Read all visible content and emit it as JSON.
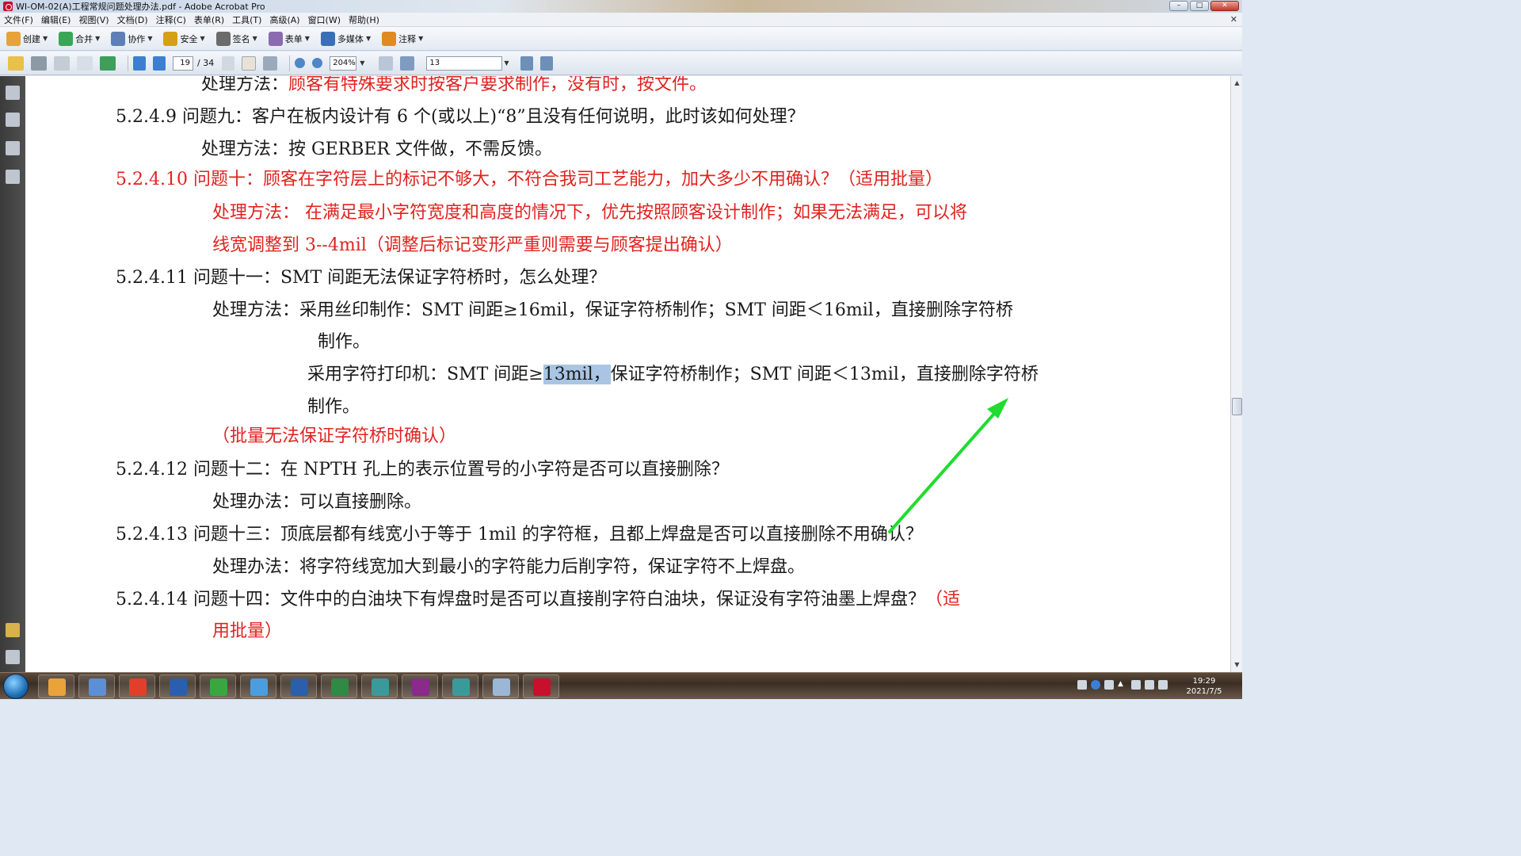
{
  "window": {
    "title": "WI-OM-02(A)工程常规问题处理办法.pdf - Adobe Acrobat Pro",
    "controls": {
      "minimize": "–",
      "maximize": "□",
      "close": "✕"
    }
  },
  "menu": {
    "items": [
      "文件(F)",
      "编辑(E)",
      "视图(V)",
      "文档(D)",
      "注释(C)",
      "表单(R)",
      "工具(T)",
      "高级(A)",
      "窗口(W)",
      "帮助(H)"
    ],
    "close": "✕"
  },
  "toolbar1": {
    "buttons": [
      {
        "label": "创建",
        "icon": "create-icon",
        "color": "#e8a23a"
      },
      {
        "label": "合并",
        "icon": "combine-icon",
        "color": "#3aa655"
      },
      {
        "label": "协作",
        "icon": "collaborate-icon",
        "color": "#5d7fb5"
      },
      {
        "label": "安全",
        "icon": "lock-icon",
        "color": "#d4a017"
      },
      {
        "label": "签名",
        "icon": "pen-icon",
        "color": "#6b6b6b"
      },
      {
        "label": "表单",
        "icon": "form-icon",
        "color": "#8a6bb0"
      },
      {
        "label": "多媒体",
        "icon": "multimedia-icon",
        "color": "#3b6fb5"
      },
      {
        "label": "注释",
        "icon": "comment-icon",
        "color": "#e08a20"
      }
    ]
  },
  "toolbar2": {
    "current_page": "19",
    "total_pages": "/ 34",
    "zoom": "204%",
    "search_value": "13"
  },
  "document": {
    "lines": [
      {
        "segs": [
          {
            "t": "处理方法："
          },
          {
            "t": "顾客有特殊要求时按客户要求制作，没有时，按文件。",
            "c": "red"
          }
        ]
      },
      {
        "segs": [
          {
            "t": "5.2.4.9 问题九：客户在板内设计有 6 个(或以上)“8”且没有任何说明，此时该如何处理？"
          }
        ]
      },
      {
        "segs": [
          {
            "t": "处理方法：按 GERBER 文件做，不需反馈。"
          }
        ]
      },
      {
        "segs": [
          {
            "t": "5.2.4.10 问题十：顾客在字符层上的标记不够大，不符合我司工艺能力，加大多少不用确认？（适用批量）",
            "c": "red"
          }
        ]
      },
      {
        "segs": [
          {
            "t": "处理方法： 在满足最小字符宽度和高度的情况下，优先按照顾客设计制作；如果无法满足，可以将",
            "c": "red"
          }
        ]
      },
      {
        "segs": [
          {
            "t": "线宽调整到 3--4mil（调整后标记变形严重则需要与顾客提出确认）",
            "c": "red"
          }
        ]
      },
      {
        "segs": [
          {
            "t": "5.2.4.11 问题十一：SMT 间距无法保证字符桥时，怎么处理？"
          }
        ]
      },
      {
        "segs": [
          {
            "t": "处理方法：采用丝印制作：SMT 间距≥16mil，保证字符桥制作；SMT 间距＜16mil，直接删除字符桥"
          }
        ]
      },
      {
        "segs": [
          {
            "t": "制作。"
          }
        ]
      },
      {
        "segs": [
          {
            "t": "采用字符打印机：SMT 间距≥"
          },
          {
            "t": "13mil，",
            "c": "hl"
          },
          {
            "t": "保证字符桥制作；SMT 间距＜13mil，直接删除字符桥"
          }
        ]
      },
      {
        "segs": [
          {
            "t": "制作。"
          }
        ]
      },
      {
        "segs": [
          {
            "t": "（批量无法保证字符桥时确认）",
            "c": "red"
          }
        ]
      },
      {
        "segs": [
          {
            "t": "5.2.4.12 问题十二：在 NPTH 孔上的表示位置号的小字符是否可以直接删除？"
          }
        ]
      },
      {
        "segs": [
          {
            "t": "处理办法：可以直接删除。"
          }
        ]
      },
      {
        "segs": [
          {
            "t": "5.2.4.13 问题十三：顶底层都有线宽小于等于 1mil 的字符框，且都上焊盘是否可以直接删除不用确认？"
          }
        ]
      },
      {
        "segs": [
          {
            "t": "处理办法：将字符线宽加大到最小的字符能力后削字符，保证字符不上焊盘。"
          }
        ]
      },
      {
        "segs": [
          {
            "t": "5.2.4.14 问题十四：文件中的白油块下有焊盘时是否可以直接削字符白油块，保证没有字符油墨上焊盘？"
          },
          {
            "t": "（适",
            "c": "red"
          }
        ]
      },
      {
        "segs": [
          {
            "t": "用批量）",
            "c": "red"
          }
        ]
      }
    ]
  },
  "taskbar": {
    "apps": [
      {
        "icon": "sunflower-icon",
        "color": "#e9a33a"
      },
      {
        "icon": "notepad-icon",
        "color": "#5b8fd6"
      },
      {
        "icon": "g-app-icon",
        "color": "#e0402a"
      },
      {
        "icon": "floppy-icon",
        "color": "#2a5fb0"
      },
      {
        "icon": "p-app-icon",
        "color": "#3aa640"
      },
      {
        "icon": "send-icon",
        "color": "#4a9ee0"
      },
      {
        "icon": "word-icon",
        "color": "#2b5eab"
      },
      {
        "icon": "excel-icon",
        "color": "#2f8a44"
      },
      {
        "icon": "eye-app-icon",
        "color": "#3a9a9a"
      },
      {
        "icon": "x-app-icon",
        "color": "#8a2a8a"
      },
      {
        "icon": "eye-app-2-icon",
        "color": "#3a9a9a"
      },
      {
        "icon": "glass-icon",
        "color": "#9ab7d6"
      },
      {
        "icon": "acrobat-icon",
        "color": "#c8102e"
      }
    ],
    "clock_time": "19:29",
    "clock_date": "2021/7/5"
  }
}
